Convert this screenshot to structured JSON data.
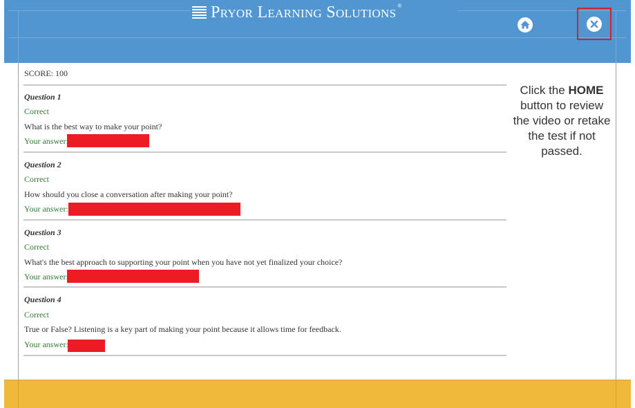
{
  "header": {
    "brand": "Pryor Learning Solutions",
    "brand_mark": "®",
    "home_icon": "home-icon",
    "close_icon": "close-icon",
    "colors": {
      "header_bg": "#5196d1",
      "footer_bg": "#f0b93b",
      "highlight": "#d3222a"
    }
  },
  "results": {
    "score": "SCORE: 100",
    "questions": [
      {
        "title": "Question 1",
        "status": "Correct",
        "text": "What is the best way to make your point?",
        "answer_label": "Your answer:"
      },
      {
        "title": "Question 2",
        "status": "Correct",
        "text": "How should you close a conversation after making your point?",
        "answer_label": "Your answer:"
      },
      {
        "title": "Question 3",
        "status": "Correct",
        "text": "What's the best approach to supporting your point when you have not yet finalized your choice?",
        "answer_label": "Your answer:"
      },
      {
        "title": "Question 4",
        "status": "Correct",
        "text": "True or False? Listening is a key part of making your point because it allows time for feedback.",
        "answer_label": "Your answer:"
      }
    ]
  },
  "hint": {
    "before": "Click the ",
    "emphasis": "HOME",
    "after": " button to review the video or retake the test if not passed."
  }
}
